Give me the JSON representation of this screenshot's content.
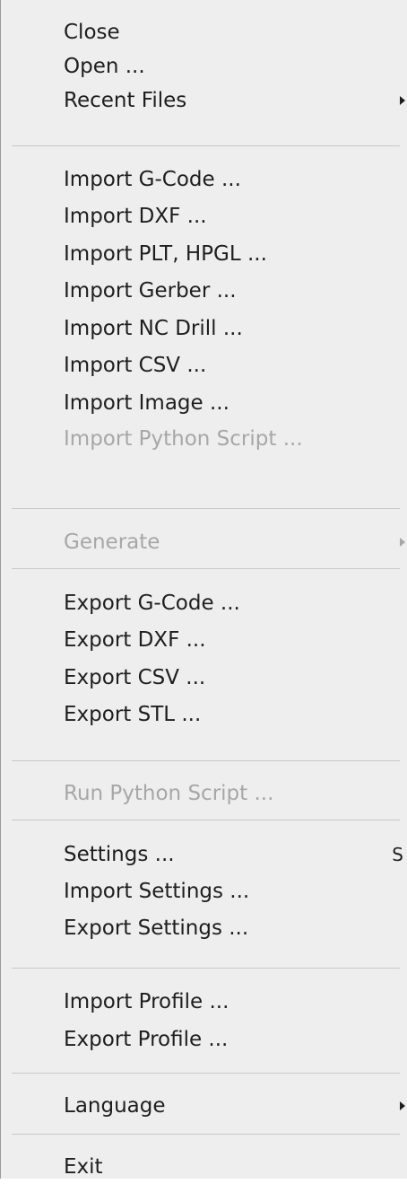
{
  "menu": {
    "items": [
      {
        "label": "Close"
      },
      {
        "label": "Open ..."
      },
      {
        "label": "Recent Files"
      },
      {
        "label": "Import G-Code ..."
      },
      {
        "label": "Import DXF ..."
      },
      {
        "label": "Import PLT, HPGL ..."
      },
      {
        "label": "Import Gerber ..."
      },
      {
        "label": "Import NC Drill ..."
      },
      {
        "label": "Import CSV ..."
      },
      {
        "label": "Import Image ..."
      },
      {
        "label": "Import Python Script ..."
      },
      {
        "label": "Generate"
      },
      {
        "label": "Export G-Code ..."
      },
      {
        "label": "Export DXF ..."
      },
      {
        "label": "Export CSV ..."
      },
      {
        "label": "Export STL ..."
      },
      {
        "label": "Run Python Script ..."
      },
      {
        "label": "Settings ...",
        "shortcut": "S"
      },
      {
        "label": "Import Settings ..."
      },
      {
        "label": "Export Settings ..."
      },
      {
        "label": "Import Profile ..."
      },
      {
        "label": "Export Profile ..."
      },
      {
        "label": "Language"
      },
      {
        "label": "Exit"
      }
    ]
  },
  "colors": {
    "background": "#eeeeee",
    "text": "#1e1e1e",
    "disabled_text": "#a7a7a7",
    "separator": "#c9c9c9"
  }
}
